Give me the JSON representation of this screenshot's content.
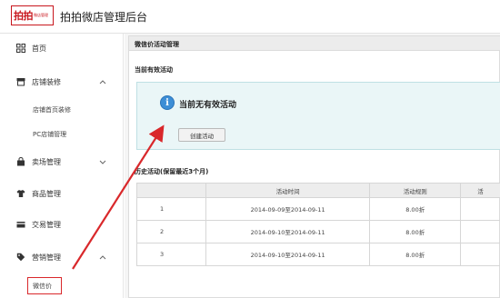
{
  "header": {
    "logo_main": "拍拍",
    "logo_small": "微店管理",
    "title": "拍拍微店管理后台"
  },
  "sidebar": {
    "items": [
      {
        "label": "首页",
        "icon": "grid-icon"
      },
      {
        "label": "店铺装修",
        "icon": "storefront-icon",
        "expanded": true
      },
      {
        "label": "卖场管理",
        "icon": "bag-icon"
      },
      {
        "label": "商品管理",
        "icon": "shirt-icon"
      },
      {
        "label": "交易管理",
        "icon": "card-icon"
      },
      {
        "label": "营销管理",
        "icon": "tag-icon",
        "expanded": true
      }
    ],
    "subitems": {
      "store": [
        "店铺首页装修",
        "PC店铺管理"
      ],
      "marketing": [
        "微信价"
      ]
    }
  },
  "main": {
    "panel_title": "微信价活动管理",
    "current_title": "当前有效活动",
    "notice": "当前无有效活动",
    "create_button": "创建活动",
    "history_title": "历史活动(保留最近3个月)",
    "table": {
      "headers": [
        "",
        "活动时间",
        "活动规则",
        "活"
      ],
      "rows": [
        [
          "1",
          "2014-09-09至2014-09-11",
          "8.00折",
          ""
        ],
        [
          "2",
          "2014-09-10至2014-09-11",
          "8.00折",
          ""
        ],
        [
          "3",
          "2014-09-10至2014-09-11",
          "8.00折",
          ""
        ]
      ]
    }
  },
  "colors": {
    "brand_red": "#c8161d",
    "arrow_red": "#d9282b",
    "notice_bg": "#eaf6f7",
    "info_blue": "#3d8ed6"
  }
}
